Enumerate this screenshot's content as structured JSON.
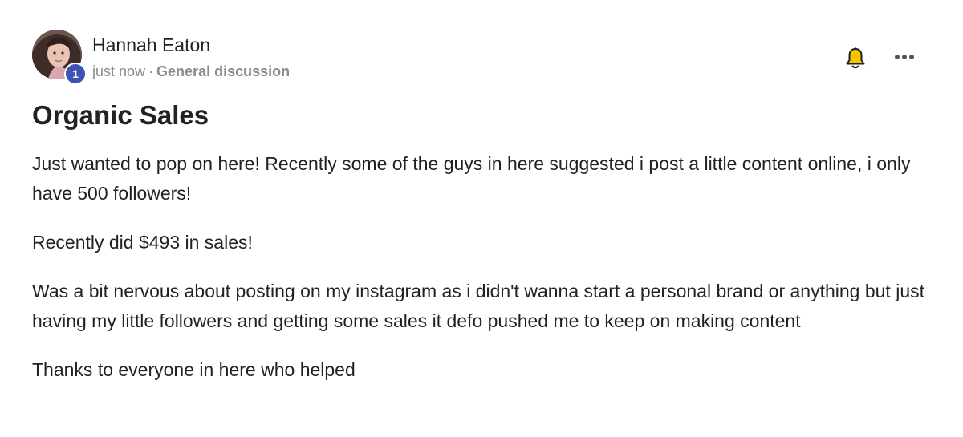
{
  "post": {
    "author": {
      "name": "Hannah Eaton",
      "level": "1"
    },
    "meta": {
      "time": "just now",
      "separator": "·",
      "category": "General discussion"
    },
    "title": "Organic Sales",
    "paragraphs": [
      "Just wanted to pop on here! Recently some of the guys in here suggested i post a little content online, i only have 500 followers!",
      "Recently did $493 in sales!",
      "Was a bit nervous about posting on my instagram as i didn't wanna start a personal brand or anything but just having my little followers and getting some sales it defo pushed me to keep on making content",
      "Thanks to everyone in here who helped"
    ]
  },
  "icons": {
    "notify": "bell-icon",
    "options": "more-options-icon"
  },
  "colors": {
    "level_badge": "#3f51b5",
    "bell": "#f5c400",
    "text": "#222222",
    "meta_text": "#8a8a8a"
  }
}
